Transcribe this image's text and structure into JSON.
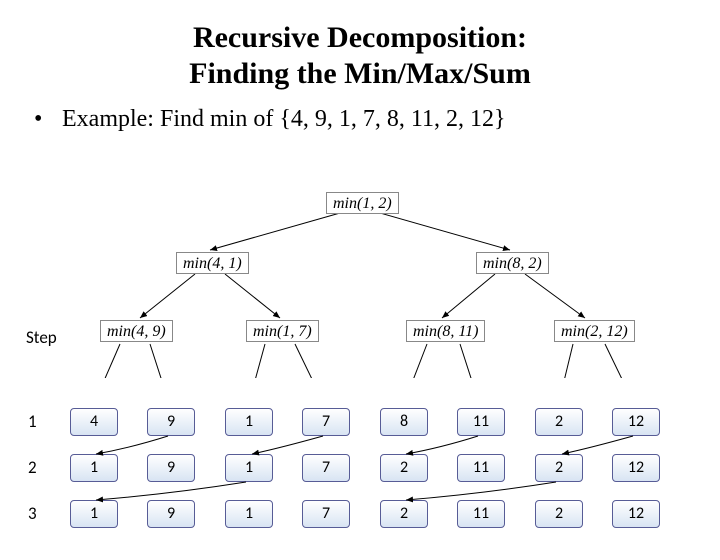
{
  "title": {
    "line1": "Recursive Decomposition:",
    "line2": "Finding the Min/Max/Sum"
  },
  "example": {
    "bullet": "•",
    "text": "Example: Find min of {4, 9, 1, 7, 8, 11, 2, 12}"
  },
  "tree": {
    "root": "min(1, 2)",
    "l": "min(4, 1)",
    "r": "min(8, 2)",
    "ll": "min(4, 9)",
    "lr": "min(1, 7)",
    "rl": "min(8, 11)",
    "rr": "min(2, 12)"
  },
  "step_header": "Step",
  "steps": [
    "1",
    "2",
    "3"
  ],
  "table": [
    [
      "4",
      "9",
      "1",
      "7",
      "8",
      "11",
      "2",
      "12"
    ],
    [
      "1",
      "9",
      "1",
      "7",
      "2",
      "11",
      "2",
      "12"
    ],
    [
      "1",
      "9",
      "1",
      "7",
      "2",
      "11",
      "2",
      "12"
    ]
  ],
  "chart_data": {
    "type": "table",
    "title": "Recursive Decomposition: Finding the Min/Max/Sum",
    "input": [
      4,
      9,
      1,
      7,
      8,
      11,
      2,
      12
    ],
    "steps": [
      {
        "step": 1,
        "array": [
          4,
          9,
          1,
          7,
          8,
          11,
          2,
          12
        ]
      },
      {
        "step": 2,
        "array": [
          1,
          9,
          1,
          7,
          2,
          11,
          2,
          12
        ]
      },
      {
        "step": 3,
        "array": [
          1,
          9,
          1,
          7,
          2,
          11,
          2,
          12
        ]
      }
    ],
    "tree": {
      "label": "min(1, 2)",
      "children": [
        {
          "label": "min(4, 1)",
          "children": [
            {
              "label": "min(4, 9)"
            },
            {
              "label": "min(1, 7)"
            }
          ]
        },
        {
          "label": "min(8, 2)",
          "children": [
            {
              "label": "min(8, 11)"
            },
            {
              "label": "min(2, 12)"
            }
          ]
        }
      ]
    }
  }
}
